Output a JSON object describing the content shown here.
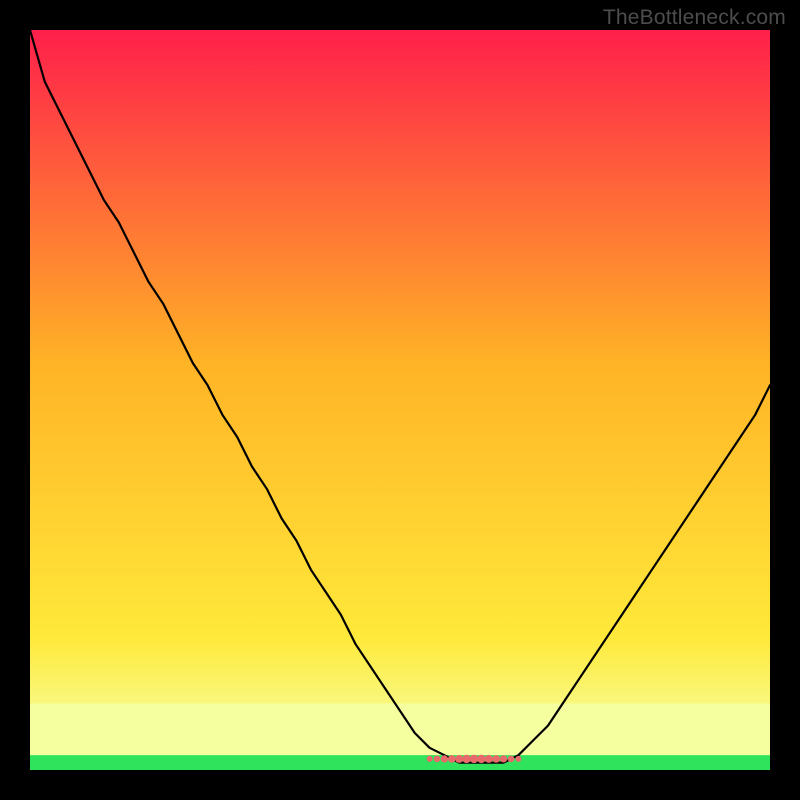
{
  "watermark": {
    "text": "TheBottleneck.com"
  },
  "colors": {
    "frame": "#000000",
    "curve": "#000000",
    "good_band": "#2fe35c",
    "soft_band": "#f6ffa0",
    "marker": "#e96a6a",
    "gradient_top": "#ff1f4b",
    "gradient_mid": "#ffb326",
    "gradient_low": "#ffe93a",
    "gradient_bottom": "#9dff5b"
  },
  "chart_data": {
    "type": "line",
    "title": "",
    "xlabel": "",
    "ylabel": "",
    "xlim": [
      0,
      100
    ],
    "ylim": [
      0,
      100
    ],
    "x": [
      0,
      2,
      4,
      6,
      8,
      10,
      12,
      14,
      16,
      18,
      20,
      22,
      24,
      26,
      28,
      30,
      32,
      34,
      36,
      38,
      40,
      42,
      44,
      46,
      48,
      50,
      52,
      54,
      56,
      58,
      60,
      62,
      64,
      66,
      68,
      70,
      72,
      74,
      76,
      78,
      80,
      82,
      84,
      86,
      88,
      90,
      92,
      94,
      96,
      98,
      100
    ],
    "values": [
      100,
      93,
      89,
      85,
      81,
      77,
      74,
      70,
      66,
      63,
      59,
      55,
      52,
      48,
      45,
      41,
      38,
      34,
      31,
      27,
      24,
      21,
      17,
      14,
      11,
      8,
      5,
      3,
      2,
      1,
      1,
      1,
      1,
      2,
      4,
      6,
      9,
      12,
      15,
      18,
      21,
      24,
      27,
      30,
      33,
      36,
      39,
      42,
      45,
      48,
      52
    ],
    "good_band_y": [
      0,
      2
    ],
    "soft_band_y": [
      2,
      9
    ],
    "marker_segment_x": [
      54,
      66
    ],
    "marker_y": 1.5,
    "background_gradient": [
      {
        "y": 100,
        "color": "#ff1f4b"
      },
      {
        "y": 55,
        "color": "#ffb326"
      },
      {
        "y": 18,
        "color": "#ffe93a"
      },
      {
        "y": 4,
        "color": "#f6ffa0"
      },
      {
        "y": 0,
        "color": "#2fe35c"
      }
    ]
  }
}
